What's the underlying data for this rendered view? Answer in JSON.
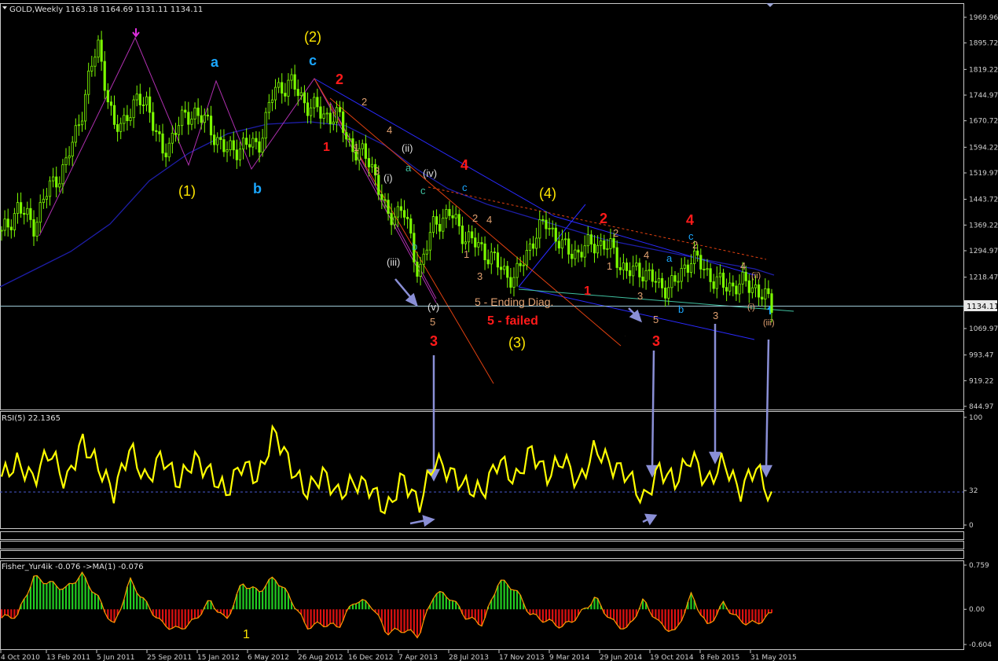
{
  "colors": {
    "background": "#000000",
    "frame": "#c8c8c8",
    "candle": "#7cfc00",
    "ma": "#1e1ea8",
    "rsi": "#ffff00",
    "fisher_pos": "#22cc22",
    "fisher_neg": "#dd1111",
    "fisher_line": "#ff9900",
    "price_line": "#9fc9d6",
    "arrow": "#8a8fd6",
    "yellow": "#ffe600",
    "red": "#ff1a1a",
    "cyan": "#1aa7ff",
    "orange": "#e0a070",
    "white": "#dddddd",
    "magenta": "#cc33cc"
  },
  "icons": {
    "menu": "triangle-down-icon",
    "peak_marker": "down-arrow-icon",
    "price_marker": "up-arrow-icon"
  },
  "price_panel": {
    "header": "GOLD,Weekly  1163.18 1164.69 1131.11 1134.11",
    "last_price": "1134.11",
    "y_ticks": [
      "1969.96",
      "1895.72",
      "1819.22",
      "1744.97",
      "1670.72",
      "1594.22",
      "1519.97",
      "1443.72",
      "1369.22",
      "1294.97",
      "1218.47",
      "1069.97",
      "993.47",
      "919.22",
      "844.97"
    ]
  },
  "rsi_panel": {
    "header": "RSI(5) 22.1365",
    "y_ticks": [
      "100",
      "32",
      "0"
    ]
  },
  "fisher_panel": {
    "header": "Fisher_Yur4ik -0.076  ->MA(1) -0.076",
    "y_ticks": [
      "0.759",
      "0.00",
      "-0.604"
    ]
  },
  "x_axis": {
    "labels": [
      "4 Oct 2010",
      "13 Feb 2011",
      "5 Jun 2011",
      "25 Sep 2011",
      "15 Jan 2012",
      "6 May 2012",
      "26 Aug 2012",
      "16 Dec 2012",
      "7 Apr 2013",
      "28 Jul 2013",
      "17 Nov 2013",
      "9 Mar 2014",
      "29 Jun 2014",
      "19 Oct 2014",
      "8 Feb 2015",
      "31 May 2015"
    ]
  },
  "annotations": {
    "yellow": [
      "(2)",
      "(1)",
      "(4)",
      "(3)",
      "1"
    ],
    "cyan": [
      "a",
      "b",
      "c",
      "c",
      "a",
      "b",
      "c"
    ],
    "red": [
      "2",
      "1",
      "4",
      "3",
      "2",
      "1",
      "3",
      "4",
      "5 - failed"
    ],
    "orange": [
      "2",
      "1",
      "3",
      "4",
      "2",
      "1",
      "3",
      "4",
      "2",
      "1",
      "3",
      "4",
      "5",
      "4",
      "3",
      "5",
      "2",
      "3",
      "(ii)",
      "(i)",
      "(iii)",
      "5 - Ending Diag."
    ],
    "white": [
      "(ii)",
      "(i)",
      "(iv)",
      "(iii)",
      "(v)"
    ],
    "green": [
      "a",
      "c",
      "b",
      "a",
      "b"
    ]
  },
  "chart_data": [
    {
      "type": "candlestick",
      "title": "GOLD,Weekly",
      "ohlc_last": {
        "open": 1163.18,
        "high": 1164.69,
        "low": 1131.11,
        "close": 1134.11
      },
      "ylim": [
        844.97,
        1969.96
      ],
      "x": [
        "2010-10-04",
        "2010-12-01",
        "2011-02-13",
        "2011-04-01",
        "2011-06-05",
        "2011-08-01",
        "2011-09-05",
        "2011-09-25",
        "2011-10-25",
        "2011-11-15",
        "2011-12-28",
        "2012-01-15",
        "2012-03-01",
        "2012-04-01",
        "2012-05-06",
        "2012-06-15",
        "2012-07-20",
        "2012-08-26",
        "2012-10-05",
        "2012-11-01",
        "2012-12-16",
        "2013-01-25",
        "2013-03-01",
        "2013-04-07",
        "2013-04-20",
        "2013-05-15",
        "2013-06-28",
        "2013-07-28",
        "2013-08-28",
        "2013-09-20",
        "2013-10-20",
        "2013-11-17",
        "2013-12-28",
        "2014-02-01",
        "2014-03-09",
        "2014-04-15",
        "2014-05-20",
        "2014-06-29",
        "2014-08-01",
        "2014-09-05",
        "2014-10-19",
        "2014-11-05",
        "2014-12-01",
        "2015-01-20",
        "2015-02-08",
        "2015-03-15",
        "2015-04-20",
        "2015-05-31",
        "2015-06-20"
      ],
      "close": [
        1340,
        1420,
        1370,
        1480,
        1540,
        1700,
        1900,
        1640,
        1700,
        1740,
        1570,
        1660,
        1700,
        1650,
        1580,
        1600,
        1600,
        1760,
        1780,
        1720,
        1690,
        1680,
        1580,
        1560,
        1390,
        1420,
        1230,
        1380,
        1400,
        1330,
        1300,
        1250,
        1210,
        1320,
        1380,
        1300,
        1290,
        1320,
        1300,
        1230,
        1240,
        1190,
        1200,
        1280,
        1230,
        1190,
        1200,
        1190,
        1134.11
      ],
      "ma": [
        1200,
        1230,
        1280,
        1320,
        1360,
        1420,
        1480,
        1520,
        1560,
        1590,
        1610,
        1630,
        1640,
        1650,
        1660,
        1665,
        1670,
        1680,
        1690,
        1690,
        1685,
        1670,
        1650,
        1630,
        1600,
        1570,
        1530,
        1500,
        1470,
        1440,
        1410,
        1380,
        1350,
        1330,
        1320,
        1310,
        1300,
        1295,
        1290,
        1285,
        1280,
        1275,
        1270,
        1265,
        1260,
        1255,
        1250,
        1245,
        1240
      ],
      "annotations": [
        "(1)",
        "(2)",
        "(3)",
        "(4)",
        "5 - Ending Diag.",
        "5 - failed"
      ]
    },
    {
      "type": "line",
      "title": "RSI(5) 22.1365",
      "ylim": [
        0,
        100
      ],
      "y": [
        45,
        58,
        42,
        70,
        38,
        78,
        55,
        30,
        72,
        40,
        65,
        38,
        62,
        48,
        30,
        58,
        42,
        88,
        55,
        30,
        48,
        28,
        40,
        35,
        12,
        45,
        18,
        60,
        48,
        35,
        30,
        62,
        40,
        70,
        45,
        62,
        38,
        72,
        55,
        48,
        22,
        52,
        40,
        65,
        38,
        60,
        30,
        55,
        22.1365
      ],
      "reference_line": 32
    },
    {
      "type": "bar",
      "title": "Fisher_Yur4ik",
      "ylim": [
        -0.604,
        0.759
      ],
      "y": [
        -0.15,
        -0.1,
        0.55,
        0.45,
        0.35,
        0.6,
        0.2,
        -0.3,
        0.5,
        0.1,
        -0.25,
        -0.35,
        -0.2,
        0.15,
        -0.2,
        0.45,
        0.3,
        0.55,
        0.2,
        -0.3,
        -0.25,
        -0.3,
        0.15,
        0.1,
        -0.4,
        -0.35,
        -0.45,
        0.3,
        0.2,
        -0.15,
        -0.25,
        0.5,
        0.35,
        -0.1,
        -0.2,
        -0.3,
        -0.1,
        0.2,
        -0.2,
        -0.35,
        0.15,
        -0.25,
        -0.4,
        0.25,
        -0.3,
        0.1,
        -0.2,
        -0.25,
        -0.076
      ]
    }
  ]
}
